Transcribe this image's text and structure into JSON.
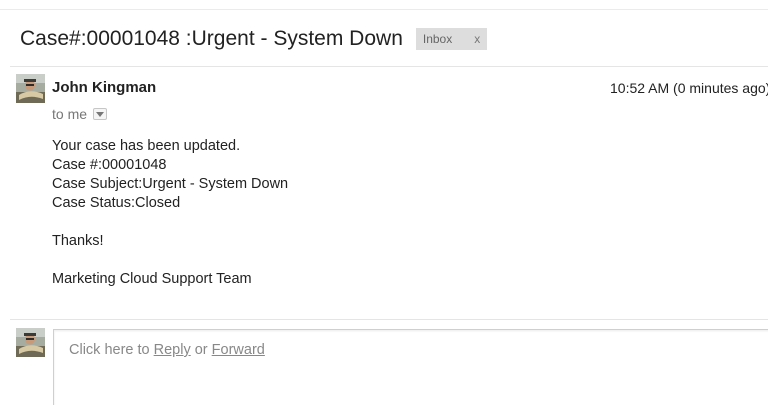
{
  "thread": {
    "subject": "Case#:00001048 :Urgent - System Down",
    "label": {
      "name": "Inbox",
      "remove": "x"
    }
  },
  "message": {
    "sender": "John Kingman",
    "timestamp": "10:52 AM (0 minutes ago)",
    "recipient": "to me",
    "recipient_dropdown_icon": "chevron-down-icon",
    "body": {
      "line1": "Your case has been updated.",
      "line2": "Case #:00001048",
      "line3": "Case Subject:Urgent - System Down",
      "line4": "Case Status:Closed",
      "line5": "Thanks!",
      "line6": "Marketing Cloud Support Team"
    }
  },
  "reply": {
    "prefix": "Click here to",
    "reply_link": "Reply",
    "connector": "or",
    "forward_link": "Forward"
  },
  "colors": {
    "label_bg": "#dddddd",
    "text": "#222222",
    "muted": "#777777"
  }
}
